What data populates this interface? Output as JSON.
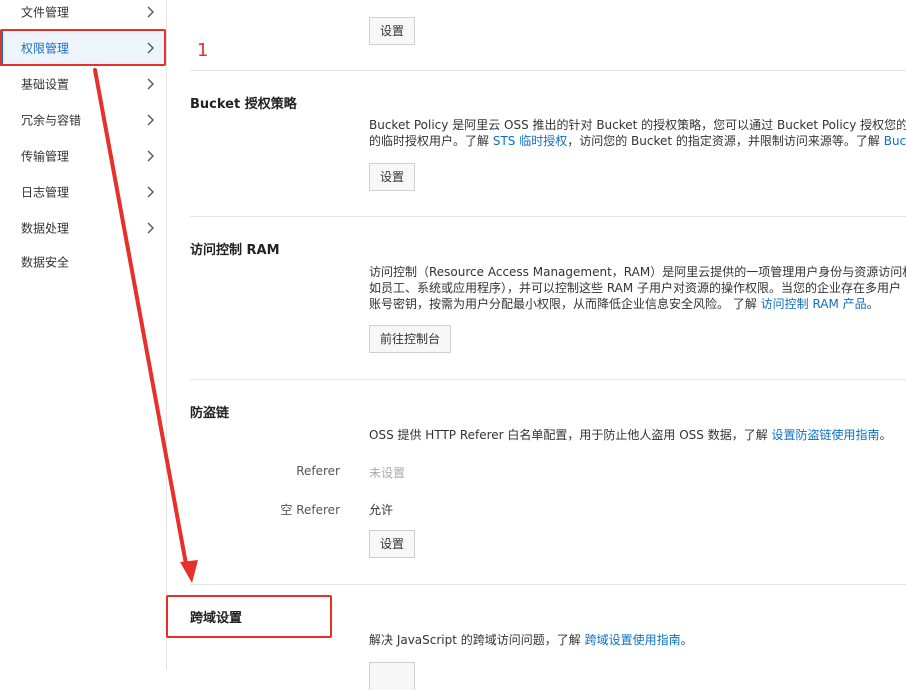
{
  "sidebar": {
    "items": [
      {
        "label": "文件管理",
        "has_arrow": true
      },
      {
        "label": "权限管理",
        "has_arrow": true,
        "active": true
      },
      {
        "label": "基础设置",
        "has_arrow": true
      },
      {
        "label": "冗余与容错",
        "has_arrow": true
      },
      {
        "label": "传输管理",
        "has_arrow": true
      },
      {
        "label": "日志管理",
        "has_arrow": true
      },
      {
        "label": "数据处理",
        "has_arrow": true
      },
      {
        "label": "数据安全",
        "has_arrow": false
      }
    ]
  },
  "annotation": {
    "number": "1",
    "color": "#e8302a"
  },
  "sections": {
    "top": {
      "button": "设置"
    },
    "bucket_policy": {
      "title": "Bucket 授权策略",
      "line1": "Bucket Policy 是阿里云 OSS 推出的针对 Bucket 的授权策略，您可以通过 Bucket Policy 授权您的 R",
      "line2_pre": "的临时授权用户。了解 ",
      "line2_link1": "STS 临时授权",
      "line2_mid": "，访问您的 Bucket 的指定资源，并限制访问来源等。了解 ",
      "line2_link2": "Buck",
      "button": "设置"
    },
    "ram": {
      "title": "访问控制 RAM",
      "line1": "访问控制（Resource Access Management，RAM）是阿里云提供的一项管理用户身份与资源访问权",
      "line2": "如员工、系统或应用程序），并可以控制这些 RAM 子用户对资源的操作权限。当您的企业存在多用户",
      "line3_pre": "账号密钥，按需为用户分配最小权限，从而降低企业信息安全风险。 了解 ",
      "line3_link": "访问控制 RAM 产品",
      "line3_post": "。",
      "button": "前往控制台"
    },
    "hotlink": {
      "title": "防盗链",
      "desc_pre": "OSS 提供 HTTP Referer 白名单配置，用于防止他人盗用 OSS 数据，了解 ",
      "desc_link": "设置防盗链使用指南",
      "desc_post": "。",
      "referer_label": "Referer",
      "referer_value": "未设置",
      "empty_referer_label": "空 Referer",
      "empty_referer_value": "允许",
      "button": "设置"
    },
    "cors": {
      "title": "跨域设置",
      "desc_pre": "解决 JavaScript 的跨域访问问题，了解 ",
      "desc_link": "跨域设置使用指南",
      "desc_post": "。"
    }
  },
  "colors": {
    "accent": "#0c70c4",
    "annotation": "#e8302a",
    "active_bg": "#eef4fb"
  }
}
